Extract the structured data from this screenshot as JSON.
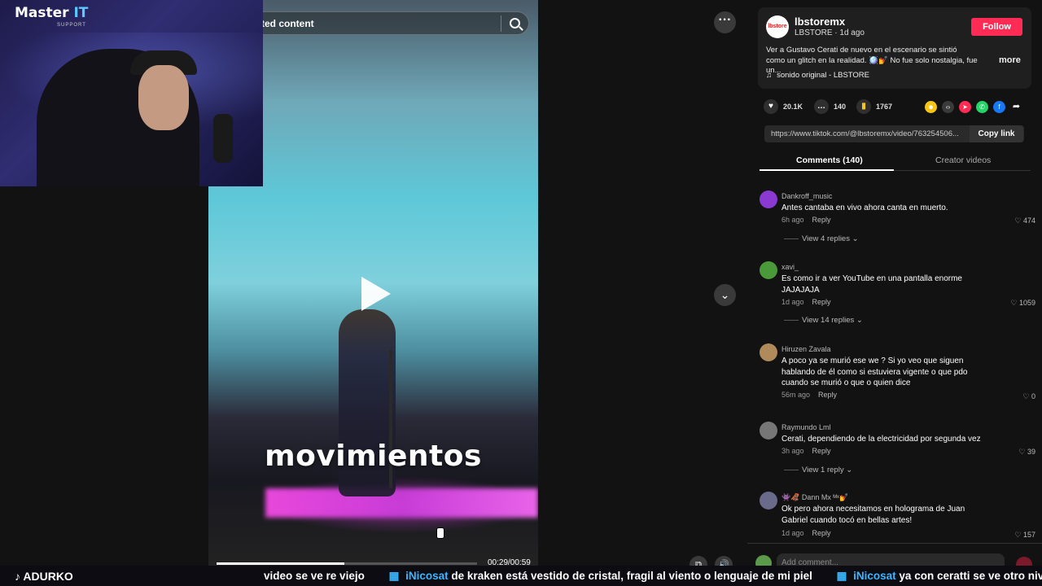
{
  "search": {
    "text": "ted content"
  },
  "video": {
    "caption": "movimientos",
    "time": "00:29/00:59",
    "progress": 0.49
  },
  "webcam": {
    "logo_main": "Master ",
    "logo_it": "IT",
    "logo_sub": "SUPPORT"
  },
  "post": {
    "avatar_text": "lbstore",
    "username": "lbstoremx",
    "subline": "LBSTORE · 1d ago",
    "follow_label": "Follow",
    "description": "Ver a Gustavo Cerati de nuevo en el escenario se sintió como un glitch en la realidad. 🪩💅 No fue solo nostalgia, fue un...",
    "more_label": "more",
    "sound": "sonido original - LBSTORE"
  },
  "stats": {
    "likes": "20.1K",
    "comments": "140",
    "saves": "1767"
  },
  "link": {
    "url": "https://www.tiktok.com/@lbstoremx/video/763254506...",
    "copy_label": "Copy link"
  },
  "tabs": {
    "comments": "Comments (140)",
    "creator": "Creator videos"
  },
  "comments": [
    {
      "name": "Dankroff_music",
      "text": "Antes cantaba en vivo ahora canta en muerto.",
      "age": "6h ago",
      "reply": "Reply",
      "likes": "474",
      "replies": "View 4 replies",
      "avatar_color": "#8a3ad0"
    },
    {
      "name": "xavi_",
      "text": "Es como ir a ver YouTube en una pantalla enorme JAJAJAJA",
      "age": "1d ago",
      "reply": "Reply",
      "likes": "1059",
      "replies": "View 14 replies",
      "avatar_color": "#4a9a3a"
    },
    {
      "name": "Hiruzen Zavala",
      "text": "A poco ya se murió ese we ? Si yo veo que siguen hablando de él como si estuviera vigente o que pdo cuando se murió o que o quien dice",
      "age": "56m ago",
      "reply": "Reply",
      "likes": "0",
      "replies": "",
      "avatar_color": "#b08a5a"
    },
    {
      "name": "Raymundo Lml",
      "text": "Cerati, dependiendo de la electricidad por segunda vez",
      "age": "3h ago",
      "reply": "Reply",
      "likes": "39",
      "replies": "View 1 reply",
      "avatar_color": "#777777"
    },
    {
      "name": "👾🦧 Dann Mx ᴹˣ💅",
      "text": "Ok pero ahora necesitamos en holograma de Juan Gabriel cuando tocó en bellas artes!",
      "age": "1d ago",
      "reply": "Reply",
      "likes": "157",
      "replies": "",
      "avatar_color": "#6a6a8a"
    }
  ],
  "add_comment": {
    "placeholder": "Add comment..."
  },
  "ticker": {
    "channel": "ADURKO",
    "msg0": "video se ve re viejo",
    "user1": "iNicosat",
    "msg1": "de kraken está vestido de cristal, fragil al viento o lenguaje de mi piel",
    "user2": "iNicosat",
    "msg2": "ya con ceratti se ve otro nivel"
  },
  "colors": {
    "follow": "#fe2c55",
    "ticker_user": "#39b6ff"
  }
}
